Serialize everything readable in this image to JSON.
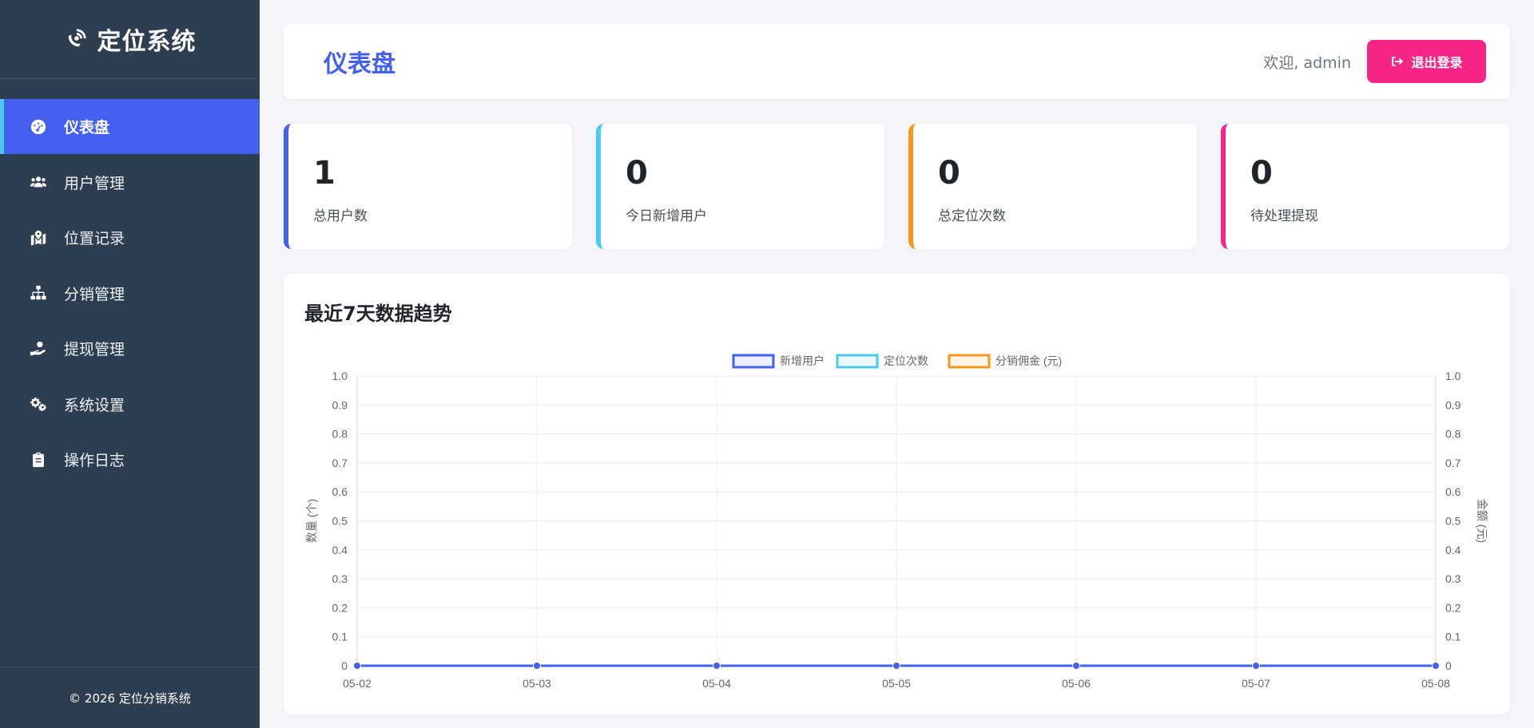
{
  "sidebar": {
    "brand_title": "定位系统",
    "brand_icon": "satellite-dish-icon",
    "items": [
      {
        "label": "仪表盘",
        "icon": "tachometer-icon",
        "active": true
      },
      {
        "label": "用户管理",
        "icon": "users-icon",
        "active": false
      },
      {
        "label": "位置记录",
        "icon": "map-marked-icon",
        "active": false
      },
      {
        "label": "分销管理",
        "icon": "sitemap-icon",
        "active": false
      },
      {
        "label": "提现管理",
        "icon": "hand-holding-dollar-icon",
        "active": false
      },
      {
        "label": "系统设置",
        "icon": "cogs-icon",
        "active": false
      },
      {
        "label": "操作日志",
        "icon": "clipboard-icon",
        "active": false
      }
    ],
    "footer": "© 2026 定位分销系统"
  },
  "header": {
    "title": "仪表盘",
    "welcome": "欢迎, admin",
    "logout_label": "退出登录"
  },
  "stats": [
    {
      "value": "1",
      "label": "总用户数",
      "color": "#4361ee"
    },
    {
      "value": "0",
      "label": "今日新增用户",
      "color": "#4cc9f0"
    },
    {
      "value": "0",
      "label": "总定位次数",
      "color": "#f8961e"
    },
    {
      "value": "0",
      "label": "待处理提现",
      "color": "#f72585"
    }
  ],
  "colors": {
    "accent": "#4361ee",
    "sidebar_bg": "#2c3e50",
    "danger": "#f72585"
  },
  "chart_title": "最近7天数据趋势",
  "chart_data": {
    "type": "line",
    "categories": [
      "05-02",
      "05-03",
      "05-04",
      "05-05",
      "05-06",
      "05-07",
      "05-08"
    ],
    "series": [
      {
        "name": "新增用户",
        "values": [
          0,
          0,
          0,
          0,
          0,
          0,
          0
        ],
        "color": "#4361ee",
        "axis": "left"
      },
      {
        "name": "定位次数",
        "values": [
          0,
          0,
          0,
          0,
          0,
          0,
          0
        ],
        "color": "#4cc9f0",
        "axis": "left"
      },
      {
        "name": "分销佣金 (元)",
        "values": [
          0,
          0,
          0,
          0,
          0,
          0,
          0
        ],
        "color": "#f8961e",
        "axis": "right"
      }
    ],
    "ylabel": "数量 (个)",
    "y2label": "金额 (元)",
    "ylim": [
      0,
      1
    ],
    "y2lim": [
      0,
      1
    ],
    "yticks": [
      "0",
      "0.1",
      "0.2",
      "0.3",
      "0.4",
      "0.5",
      "0.6",
      "0.7",
      "0.8",
      "0.9",
      "1.0"
    ],
    "legend": "top",
    "grid": true
  }
}
